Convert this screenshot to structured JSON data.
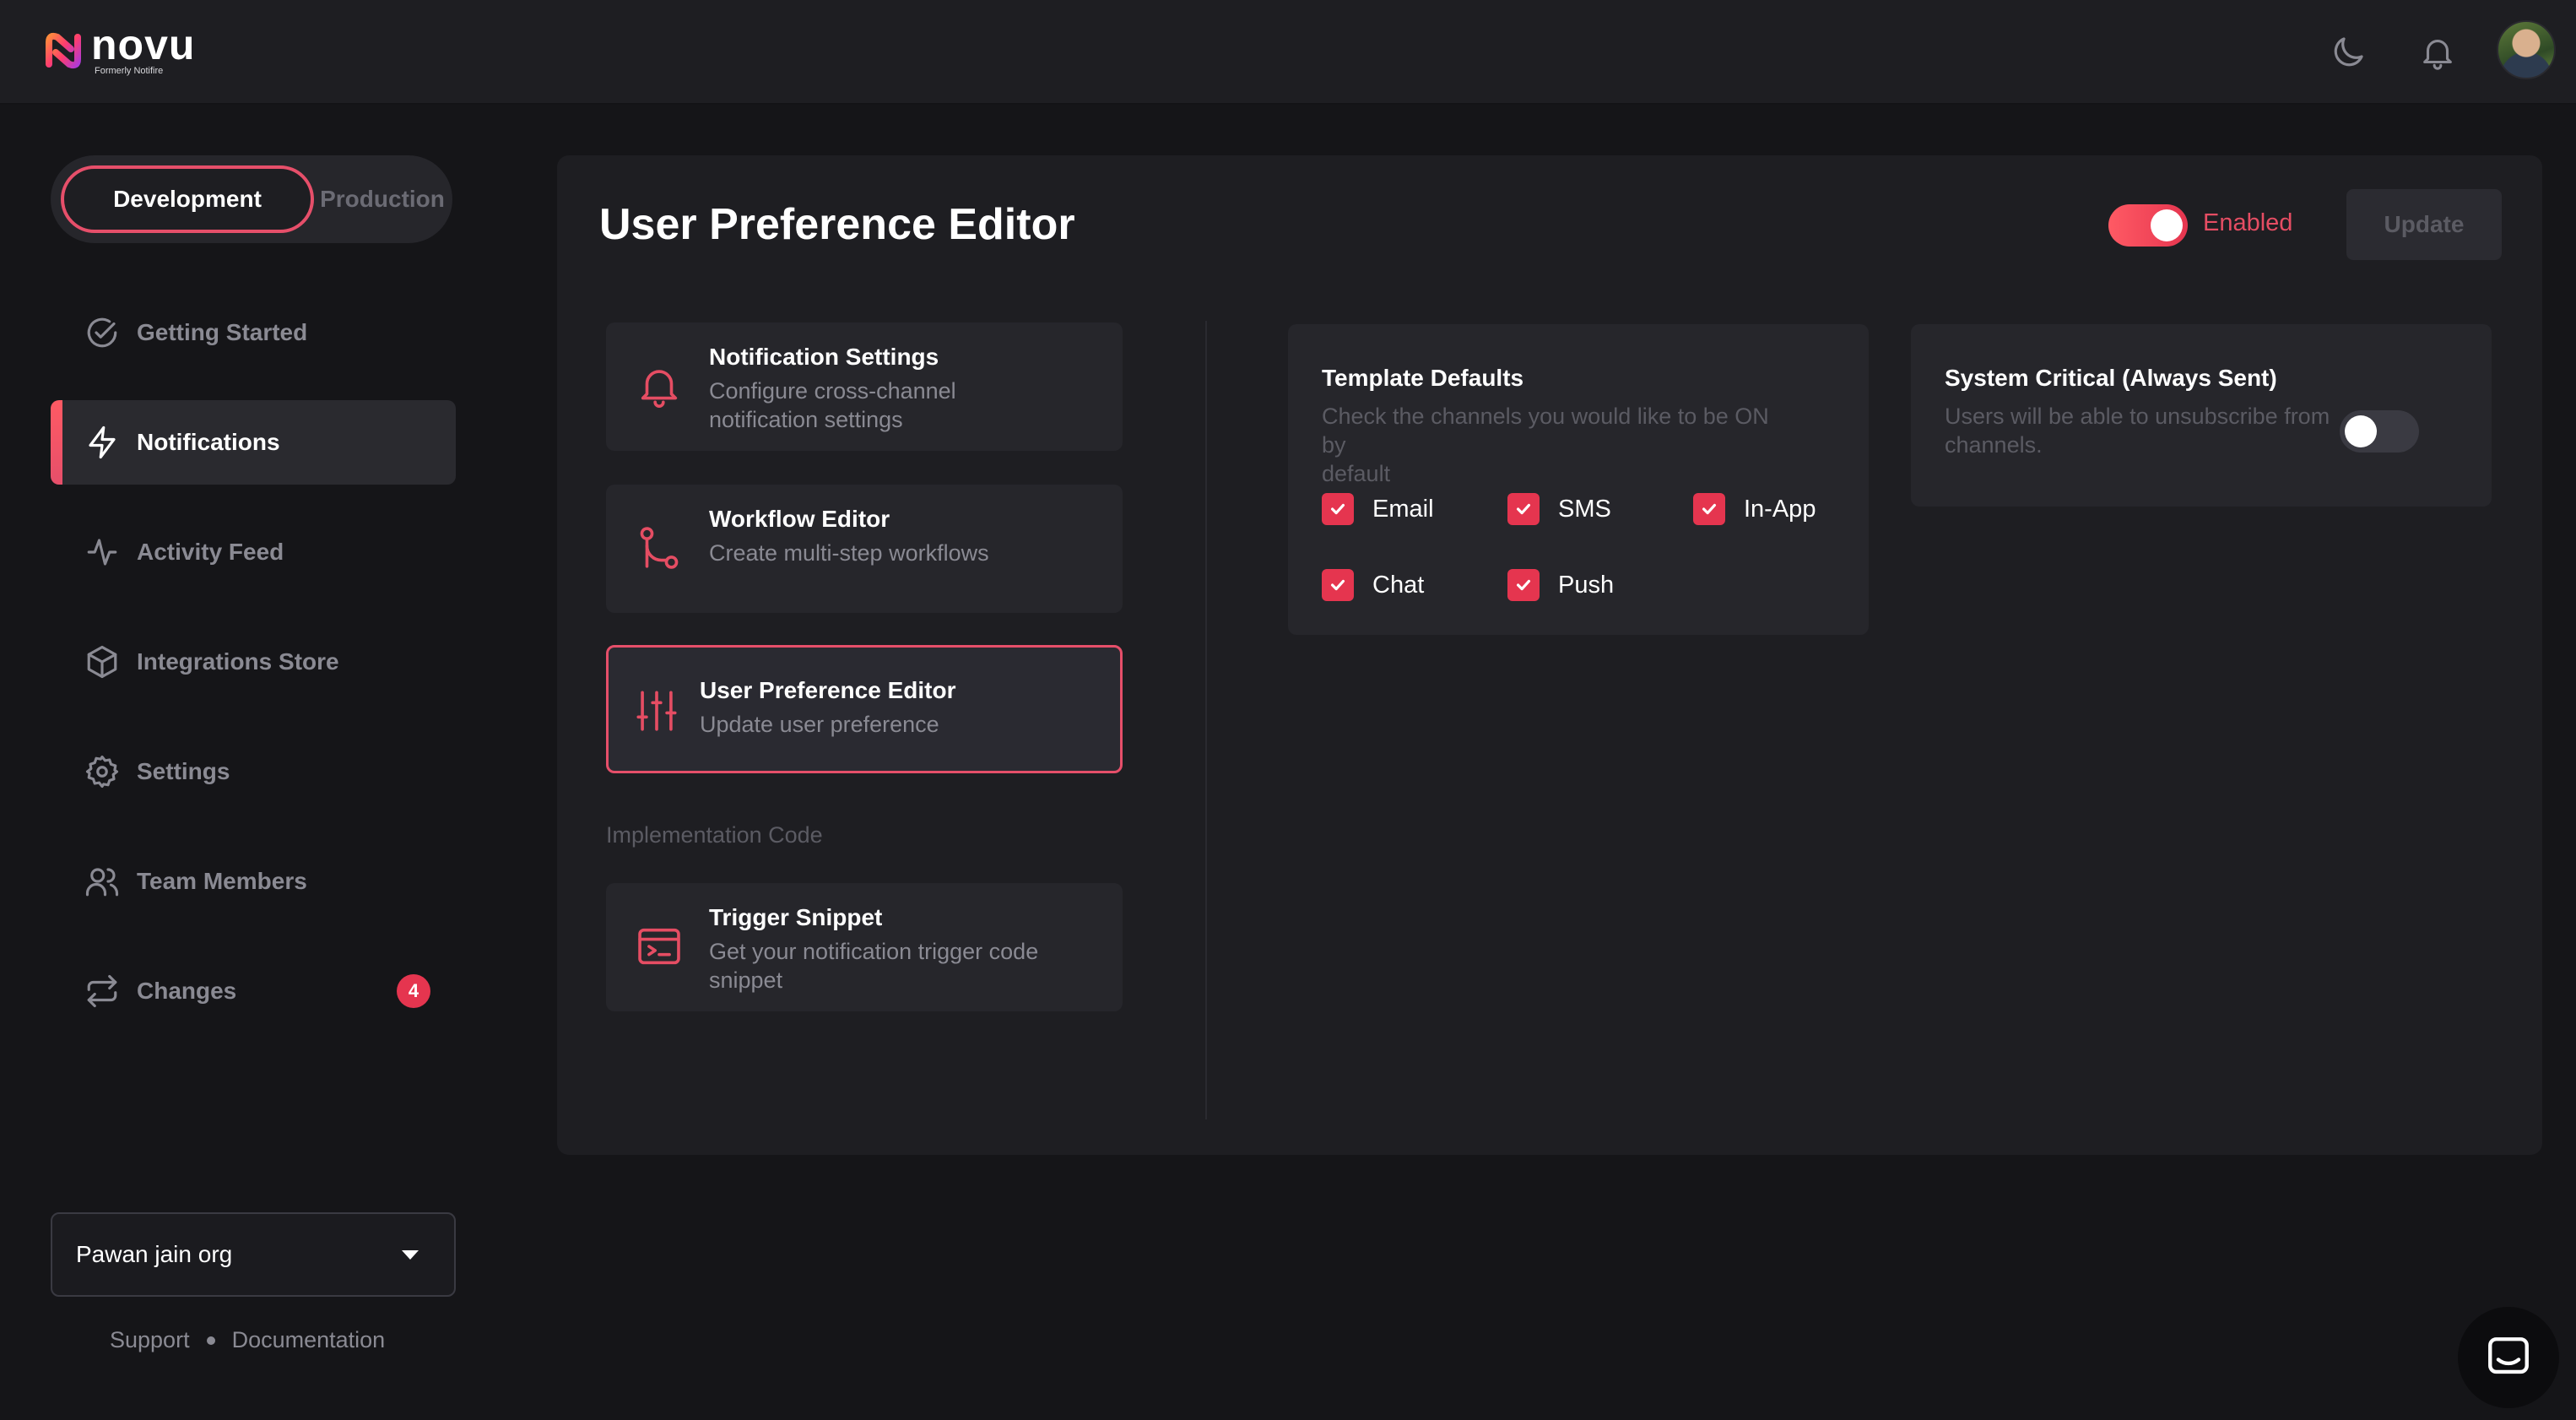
{
  "app": {
    "logo_text": "novu",
    "logo_subtitle": "Formerly Notifire"
  },
  "header": {
    "icons": [
      "moon-icon",
      "bell-icon",
      "avatar"
    ]
  },
  "environment": {
    "options": [
      "Development",
      "Production"
    ],
    "selected": "Development"
  },
  "sidebar": {
    "items": [
      {
        "label": "Getting Started",
        "icon": "check-circle-icon",
        "active": false
      },
      {
        "label": "Notifications",
        "icon": "lightning-icon",
        "active": true
      },
      {
        "label": "Activity Feed",
        "icon": "activity-icon",
        "active": false
      },
      {
        "label": "Integrations Store",
        "icon": "box-icon",
        "active": false
      },
      {
        "label": "Settings",
        "icon": "gear-icon",
        "active": false
      },
      {
        "label": "Team Members",
        "icon": "users-icon",
        "active": false
      },
      {
        "label": "Changes",
        "icon": "swap-icon",
        "active": false,
        "badge": "4"
      }
    ],
    "org": "Pawan jain org",
    "footer": {
      "support": "Support",
      "documentation": "Documentation"
    }
  },
  "main": {
    "title": "User Preference Editor",
    "status_label": "Enabled",
    "status_enabled": true,
    "update_button": "Update",
    "menu": [
      {
        "title": "Notification Settings",
        "desc_lines": [
          "Configure cross-channel",
          "notification settings"
        ],
        "icon": "bell-icon",
        "active": false
      },
      {
        "title": "Workflow Editor",
        "desc_lines": [
          "Create multi-step workflows"
        ],
        "icon": "workflow-icon",
        "active": false
      },
      {
        "title": "User Preference Editor",
        "desc_lines": [
          "Update user preference"
        ],
        "icon": "sliders-icon",
        "active": true
      }
    ],
    "implementation_label": "Implementation Code",
    "snippet": {
      "title": "Trigger Snippet",
      "desc_lines": [
        "Get your notification trigger code",
        "snippet"
      ],
      "icon": "code-window-icon"
    },
    "template_defaults": {
      "title": "Template Defaults",
      "desc_lines": [
        "Check the channels you would like to be ON by",
        "default"
      ],
      "channels": [
        {
          "label": "Email",
          "checked": true
        },
        {
          "label": "SMS",
          "checked": true
        },
        {
          "label": "In-App",
          "checked": true
        },
        {
          "label": "Chat",
          "checked": true
        },
        {
          "label": "Push",
          "checked": true
        }
      ]
    },
    "system_critical": {
      "title": "System Critical (Always Sent)",
      "desc_lines": [
        "Users will be able to unsubscribe from",
        "channels."
      ],
      "enabled": false
    }
  },
  "colors": {
    "accent": "#e5354f",
    "accent_gradient_start": "#ff5a64",
    "background": "#151518",
    "panel": "#1e1e22",
    "card": "#26262b",
    "muted_text": "#8a8a93"
  }
}
